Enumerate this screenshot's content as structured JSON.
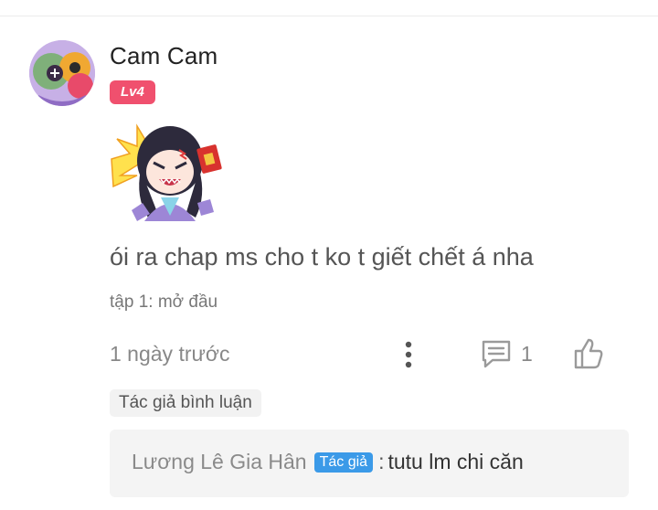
{
  "comment": {
    "username": "Cam Cam",
    "level": "Lv4",
    "text": "ói ra chap ms cho t ko t giết chết á nha",
    "chapter": "tập 1: mở đầu",
    "time_ago": "1 ngày trước",
    "reply_count": "1",
    "author_commented_tag": "Tác giả bình luận"
  },
  "reply": {
    "author": "Lương Lê Gia Hân",
    "author_badge": "Tác giả",
    "separator": ":",
    "text": "tutu lm chi căn"
  },
  "colors": {
    "level_badge": "#f0506e",
    "author_badge": "#3b9ae8",
    "icon_gray": "#9a9a9a"
  },
  "icons": {
    "more": "more-vertical-icon",
    "reply": "comment-icon",
    "like": "thumbs-up-icon"
  }
}
